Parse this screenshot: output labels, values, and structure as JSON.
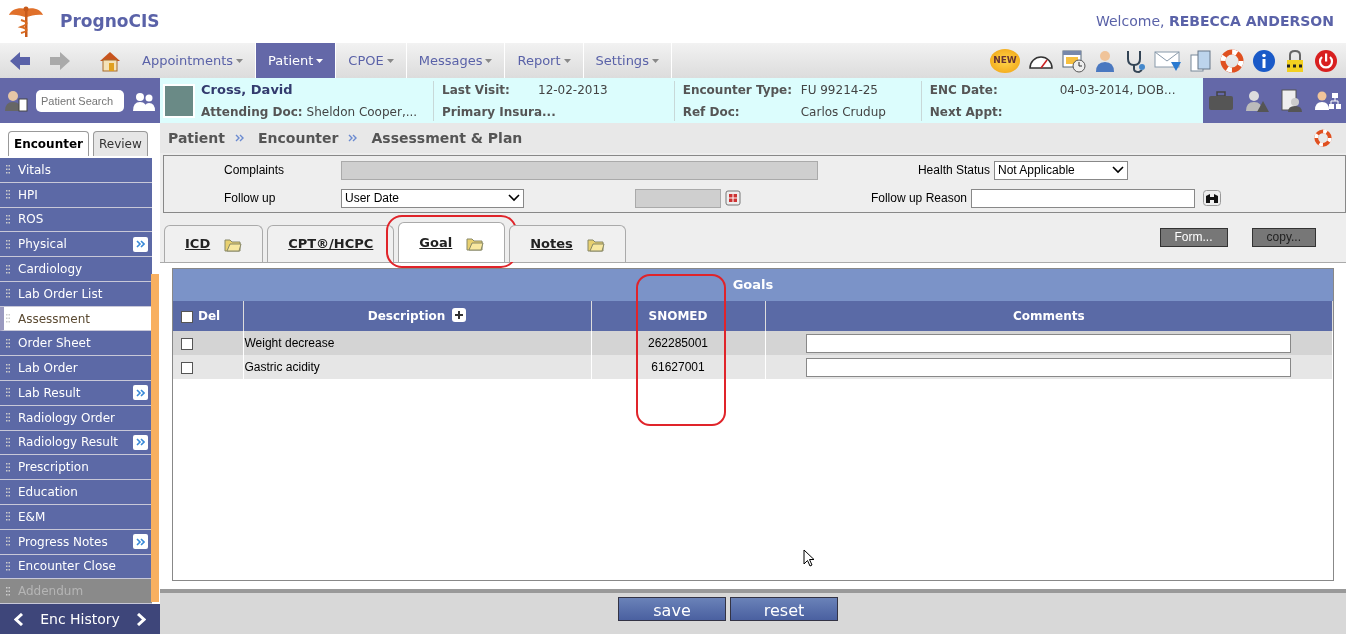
{
  "app": {
    "title": "PrognoCIS",
    "welcome": "Welcome,",
    "user": "REBECCA ANDERSON"
  },
  "new_badge": "NEW",
  "menu": [
    {
      "label": "Appointments",
      "selected": false
    },
    {
      "label": "Patient",
      "selected": true
    },
    {
      "label": "CPOE",
      "selected": false
    },
    {
      "label": "Messages",
      "selected": false
    },
    {
      "label": "Report",
      "selected": false
    },
    {
      "label": "Settings",
      "selected": false
    }
  ],
  "patient_search": {
    "placeholder": "Patient Search"
  },
  "banner": {
    "name": "Cross, David",
    "attending_label": "Attending Doc:",
    "attending_value": "Sheldon Cooper,...",
    "columns": [
      [
        {
          "label": "Last Visit:",
          "value": "12-02-2013"
        },
        {
          "label": "Primary Insura..."
        }
      ],
      [
        {
          "label": "Encounter Type:",
          "value": "FU 99214-25"
        },
        {
          "label": "Ref Doc:",
          "value": "Carlos Crudup"
        }
      ],
      [
        {
          "label": "ENC Date:",
          "value": "04-03-2014, DOB..."
        },
        {
          "label": "Next Appt:"
        }
      ]
    ]
  },
  "sidebar": {
    "tabs": [
      {
        "label": "Encounter",
        "selected": true
      },
      {
        "label": "Review",
        "selected": false
      }
    ],
    "items": [
      {
        "label": "Vitals",
        "selected": false,
        "disabled": false,
        "expandable": false
      },
      {
        "label": "HPI",
        "selected": false,
        "disabled": false,
        "expandable": false
      },
      {
        "label": "ROS",
        "selected": false,
        "disabled": false,
        "expandable": false
      },
      {
        "label": "Physical",
        "selected": false,
        "disabled": false,
        "expandable": true
      },
      {
        "label": "Cardiology",
        "selected": false,
        "disabled": false,
        "expandable": false
      },
      {
        "label": "Lab Order List",
        "selected": false,
        "disabled": false,
        "expandable": false
      },
      {
        "label": "Assessment",
        "selected": true,
        "disabled": false,
        "expandable": false
      },
      {
        "label": "Order Sheet",
        "selected": false,
        "disabled": false,
        "expandable": false
      },
      {
        "label": "Lab Order",
        "selected": false,
        "disabled": false,
        "expandable": false
      },
      {
        "label": "Lab Result",
        "selected": false,
        "disabled": false,
        "expandable": true
      },
      {
        "label": "Radiology Order",
        "selected": false,
        "disabled": false,
        "expandable": false
      },
      {
        "label": "Radiology Result",
        "selected": false,
        "disabled": false,
        "expandable": true
      },
      {
        "label": "Prescription",
        "selected": false,
        "disabled": false,
        "expandable": false
      },
      {
        "label": "Education",
        "selected": false,
        "disabled": false,
        "expandable": false
      },
      {
        "label": "E&M",
        "selected": false,
        "disabled": false,
        "expandable": false
      },
      {
        "label": "Progress Notes",
        "selected": false,
        "disabled": false,
        "expandable": true
      },
      {
        "label": "Encounter Close",
        "selected": false,
        "disabled": false,
        "expandable": false
      },
      {
        "label": "Addendum",
        "selected": false,
        "disabled": true,
        "expandable": false
      }
    ],
    "history": "Enc History"
  },
  "breadcrumb": [
    "Patient",
    "Encounter",
    "Assessment & Plan"
  ],
  "form": {
    "complaints_label": "Complaints",
    "follow_up_label": "Follow up",
    "follow_up_value": "User Date",
    "health_status_label": "Health Status",
    "health_status_value": "Not Applicable",
    "follow_up_reason_label": "Follow up Reason"
  },
  "tabs": [
    {
      "label": "ICD",
      "selected": false,
      "icon": true,
      "highlighted": false
    },
    {
      "label": "CPT®/HCPC",
      "selected": false,
      "icon": false,
      "highlighted": false
    },
    {
      "label": "Goal",
      "selected": true,
      "icon": true,
      "highlighted": true
    },
    {
      "label": "Notes",
      "selected": false,
      "icon": true,
      "highlighted": false
    }
  ],
  "tab_buttons": [
    "Form...",
    "copy..."
  ],
  "table": {
    "title": "Goals",
    "all_checked": false,
    "columns": [
      {
        "label": "Del",
        "highlighted": false
      },
      {
        "label": "Description",
        "highlighted": false
      },
      {
        "label": "SNOMED",
        "highlighted": true
      },
      {
        "label": "Comments",
        "highlighted": false
      }
    ],
    "rows": [
      {
        "checked": false,
        "description": "Weight decrease",
        "snomed": "262285001"
      },
      {
        "checked": false,
        "description": "Gastric acidity",
        "snomed": "61627001"
      }
    ]
  },
  "footer_buttons": [
    "save",
    "reset"
  ]
}
